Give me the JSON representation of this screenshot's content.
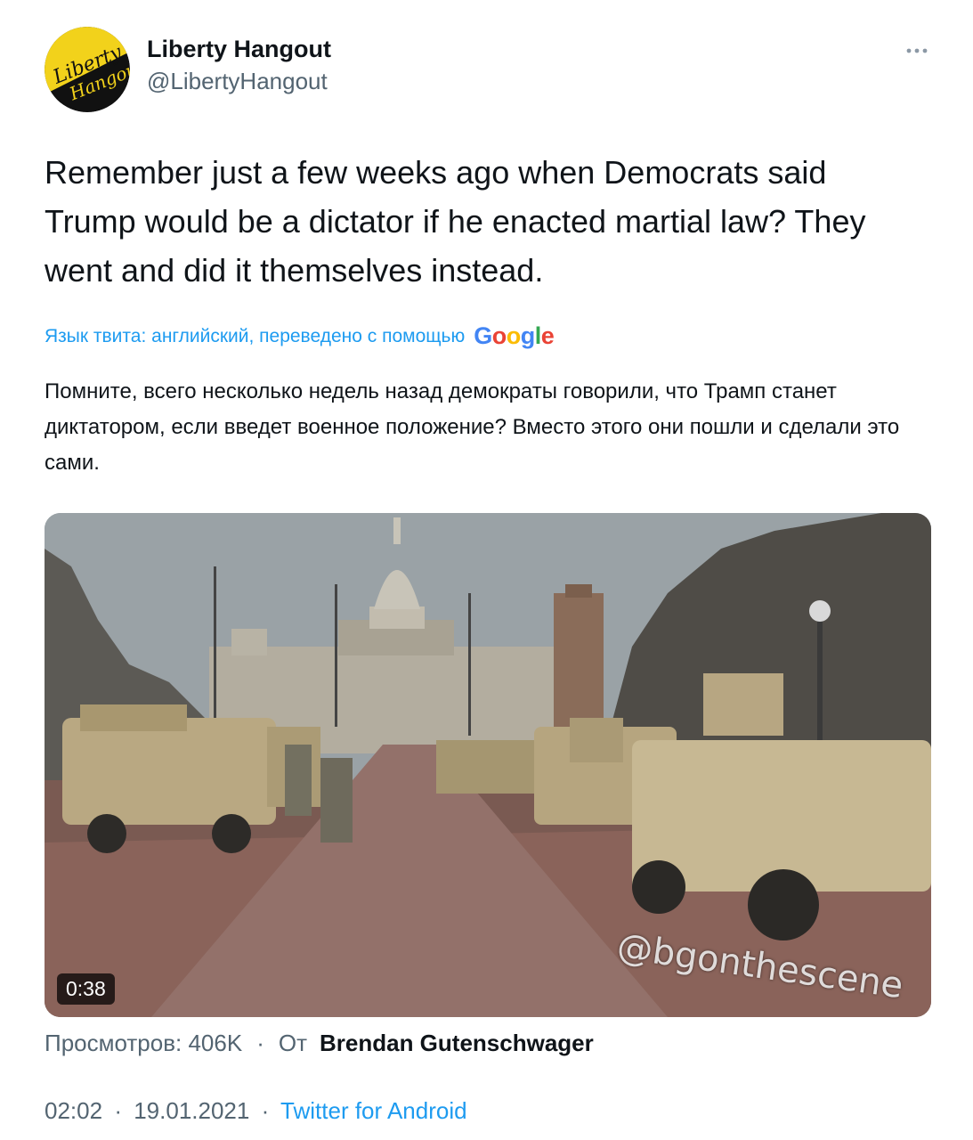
{
  "author": {
    "display_name": "Liberty Hangout",
    "handle": "@LibertyHangout",
    "avatar_line1": "Liberty",
    "avatar_line2": "Hangout"
  },
  "tweet": {
    "text": "Remember just a few weeks ago when Democrats said Trump would be a dictator if he enacted martial law? They went and did it themselves instead."
  },
  "translation": {
    "notice": "Язык твита: английский, переведено с помощью",
    "provider": "Google",
    "text": "Помните, всего несколько недель назад демократы говорили, что Трамп станет диктатором, если введет военное положение? Вместо этого они пошли и сделали это сами."
  },
  "media": {
    "duration": "0:38",
    "watermark": "@bgonthescene"
  },
  "views": {
    "label": "Просмотров: 406K",
    "separator": "·",
    "from_label": "От",
    "from_name": "Brendan Gutenschwager"
  },
  "meta": {
    "time": "02:02",
    "separator": "·",
    "date": "19.01.2021",
    "source": "Twitter for Android"
  },
  "colors": {
    "link": "#1d9bf0",
    "text": "#0f1419",
    "secondary": "#536471",
    "avatar_yellow": "#f2d21b"
  },
  "icons": [
    "more-horizontal-icon"
  ]
}
